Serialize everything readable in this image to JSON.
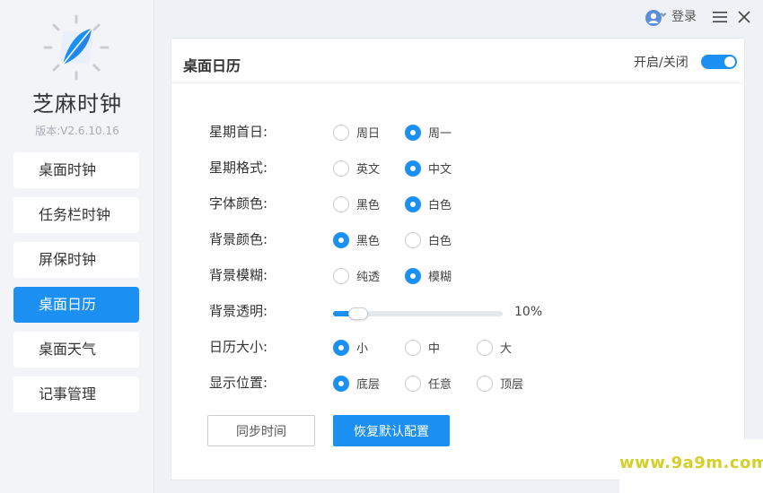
{
  "app": {
    "name": "芝麻时钟",
    "version": "版本:V2.6.10.16"
  },
  "topbar": {
    "login_label": "登录",
    "user_icon": "user-avatar-icon",
    "menu_icon": "hamburger-icon",
    "close_icon": "close-icon"
  },
  "sidebar": {
    "items": [
      {
        "label": "桌面时钟",
        "active": false
      },
      {
        "label": "任务栏时钟",
        "active": false
      },
      {
        "label": "屏保时钟",
        "active": false
      },
      {
        "label": "桌面日历",
        "active": true
      },
      {
        "label": "桌面天气",
        "active": false
      },
      {
        "label": "记事管理",
        "active": false
      }
    ]
  },
  "panel": {
    "title": "桌面日历",
    "toggle_label": "开启/关闭",
    "toggle_on": true,
    "settings": [
      {
        "label": "星期首日:",
        "options": [
          "周日",
          "周一"
        ],
        "selected": 1
      },
      {
        "label": "星期格式:",
        "options": [
          "英文",
          "中文"
        ],
        "selected": 1
      },
      {
        "label": "字体颜色:",
        "options": [
          "黑色",
          "白色"
        ],
        "selected": 1
      },
      {
        "label": "背景颜色:",
        "options": [
          "黑色",
          "白色"
        ],
        "selected": 0
      },
      {
        "label": "背景模糊:",
        "options": [
          "纯透",
          "模糊"
        ],
        "selected": 1
      },
      {
        "label": "背景透明:"
      },
      {
        "label": "日历大小:",
        "options": [
          "小",
          "中",
          "大"
        ],
        "selected": 0
      },
      {
        "label": "显示位置:",
        "options": [
          "底层",
          "任意",
          "顶层"
        ],
        "selected": 0
      }
    ],
    "transparency": {
      "value_percent": 10,
      "value_text": "10%"
    },
    "buttons": {
      "sync_time": "同步时间",
      "restore_default": "恢复默认配置"
    }
  },
  "watermark": {
    "text": "www.9a9m.com"
  },
  "colors": {
    "accent": "#1b8ff2",
    "watermark": "#d5cf2a"
  }
}
